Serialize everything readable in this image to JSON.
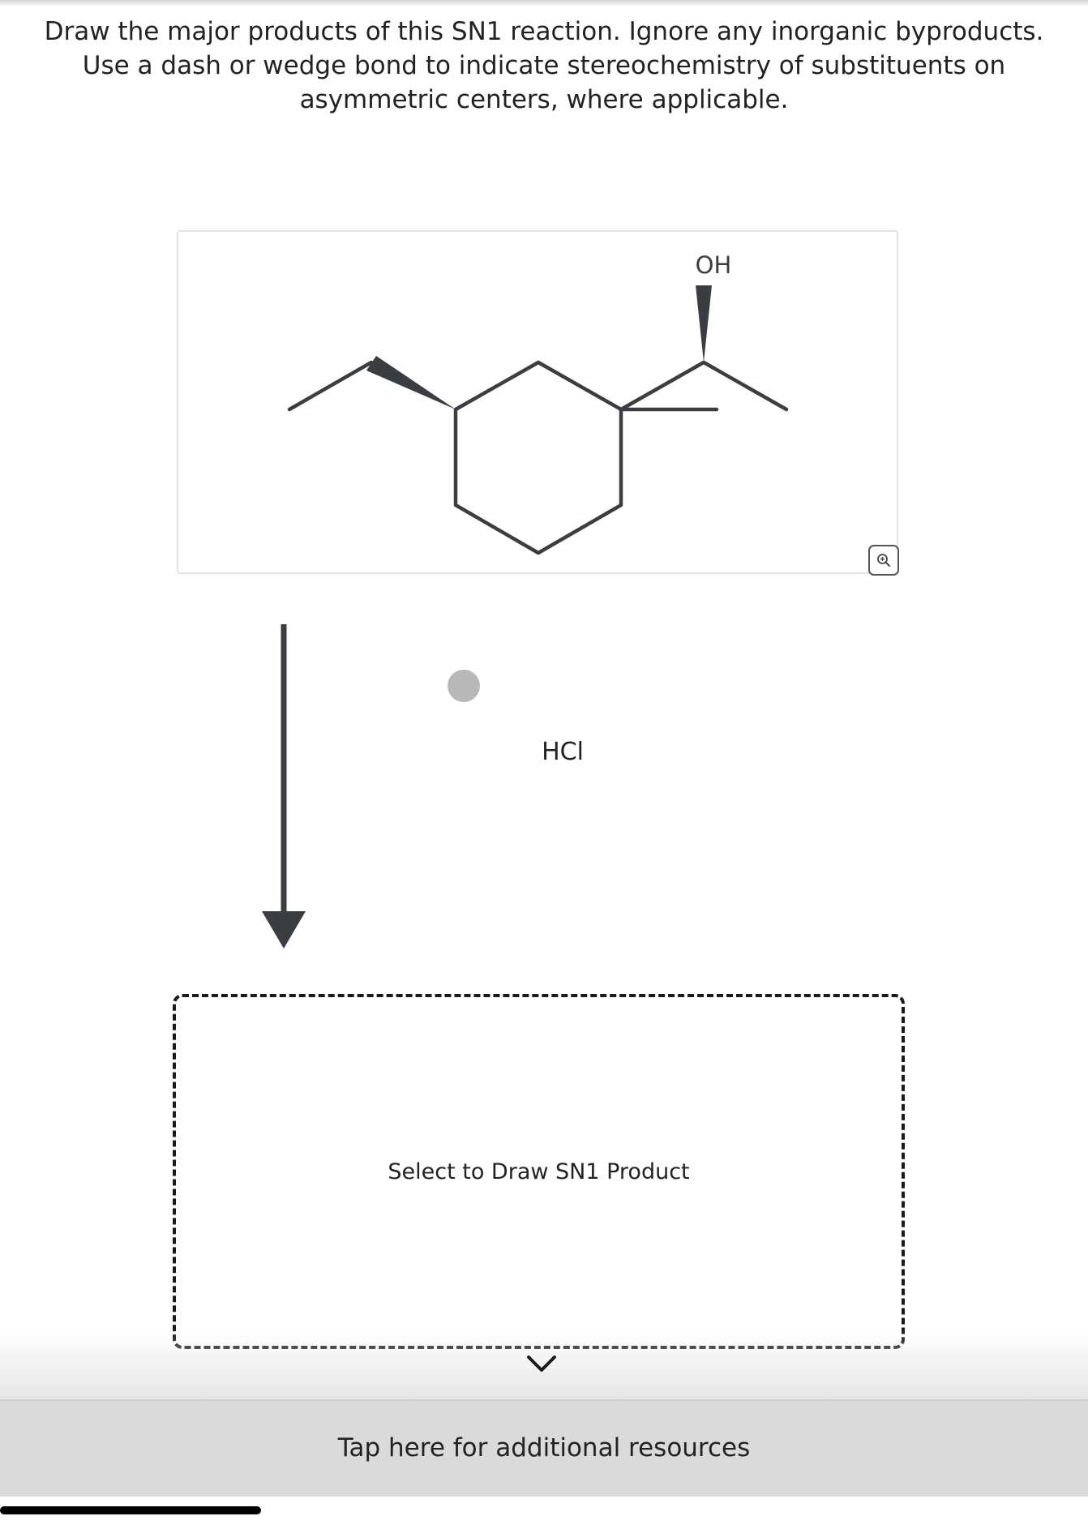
{
  "question": {
    "text": "Draw the major products of this SN1 reaction. Ignore any inorganic byproducts. Use a dash or wedge bond to indicate stereochemistry of substituents on asymmetric centers, where applicable."
  },
  "reactant": {
    "oh_label": "OH"
  },
  "reagent": {
    "label": "HCl"
  },
  "product": {
    "placeholder": "Select to Draw SN1 Product"
  },
  "footer": {
    "resources_label": "Tap here for additional resources"
  },
  "icons": {
    "zoom": "zoom-in-icon",
    "expand": "chevron-down-icon",
    "reaction_arrow": "arrow-down-icon"
  },
  "colors": {
    "bond": "#3a3d42",
    "arrow": "#3a3d42",
    "footer_bg": "#dadada"
  }
}
